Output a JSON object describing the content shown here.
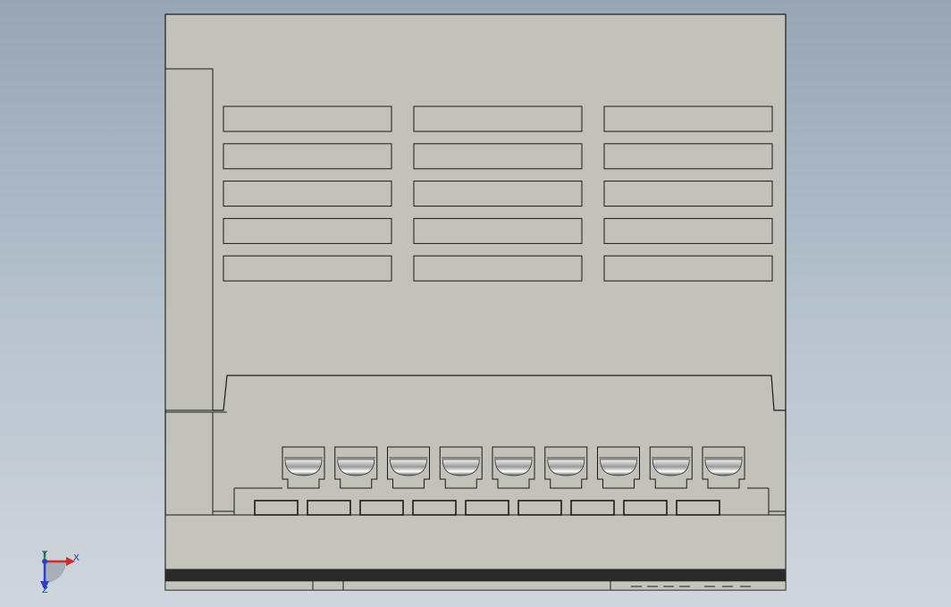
{
  "scene": {
    "background_top": "#97a5b6",
    "background_bottom": "#cfd6dd",
    "part_face_color": "#c0c0b8",
    "edge_color": "#1b1b1b",
    "recess_color": "#bcbcb4",
    "dark_base_color": "#2a2a2a",
    "screw_color": "#d9d9d9"
  },
  "part": {
    "vent_slot_columns": 3,
    "vent_slot_rows": 5,
    "terminal_screw_count": 9,
    "terminal_slot_count": 9
  },
  "triad": {
    "x_label": "X",
    "y_label": "Y",
    "z_label": "Z",
    "x_color": "#d12a2a",
    "y_color": "#2a9d2a",
    "z_color": "#2a3fd1"
  }
}
